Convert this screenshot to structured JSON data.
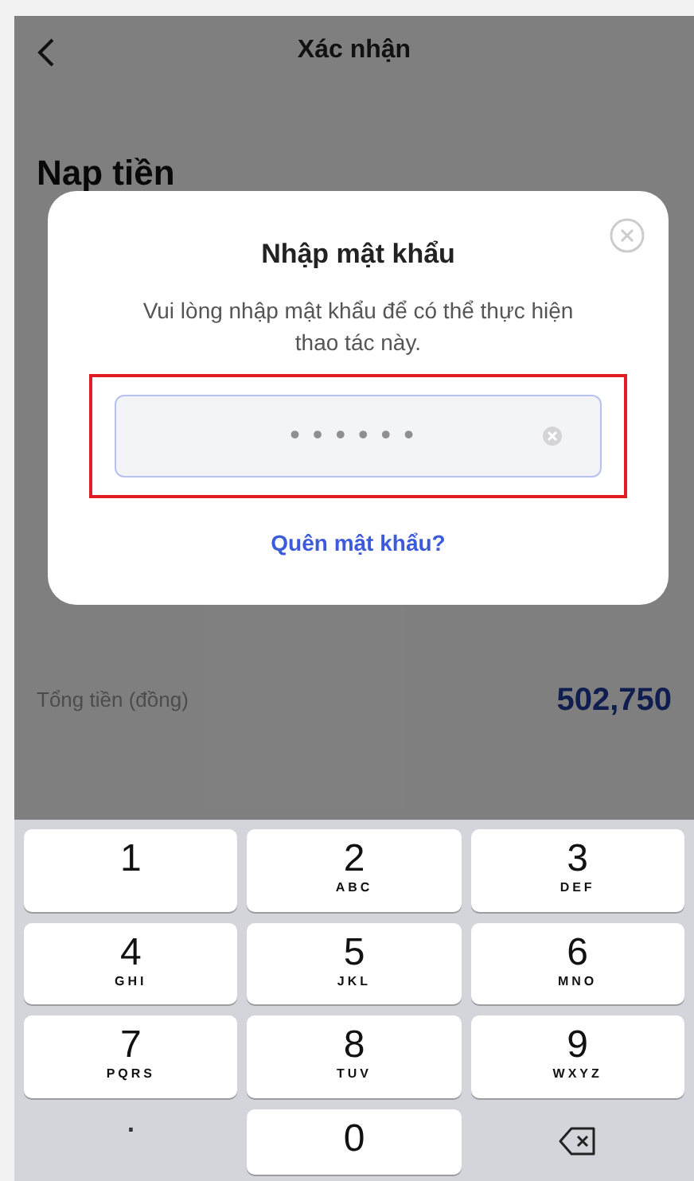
{
  "header": {
    "title": "Xác nhận"
  },
  "page_title": "Nap tiền",
  "summary": {
    "label": "Tổng tiền (đồng)",
    "value": "502,750"
  },
  "dialog": {
    "title": "Nhập mật khẩu",
    "message": "Vui lòng nhập mật khẩu để có thể thực hiện thao tác này.",
    "field": {
      "value": "••••••",
      "highlighted": true
    },
    "link": "Quên mật khẩu?"
  },
  "keypad": [
    {
      "kind": "digit",
      "digit": "1"
    },
    {
      "kind": "digit",
      "digit": "2",
      "letters": "ABC"
    },
    {
      "kind": "digit",
      "digit": "3",
      "letters": "DEF"
    },
    {
      "kind": "digit",
      "digit": "4",
      "letters": "GHI"
    },
    {
      "kind": "digit",
      "digit": "5",
      "letters": "JKL"
    },
    {
      "kind": "digit",
      "digit": "6",
      "letters": "MNO"
    },
    {
      "kind": "digit",
      "digit": "7",
      "letters": "PQRS"
    },
    {
      "kind": "digit",
      "digit": "8",
      "letters": "TUV"
    },
    {
      "kind": "digit",
      "digit": "9",
      "letters": "WXYZ"
    },
    {
      "kind": "symbol",
      "digit": "."
    },
    {
      "kind": "digit",
      "digit": "0"
    },
    {
      "kind": "backspace"
    }
  ]
}
